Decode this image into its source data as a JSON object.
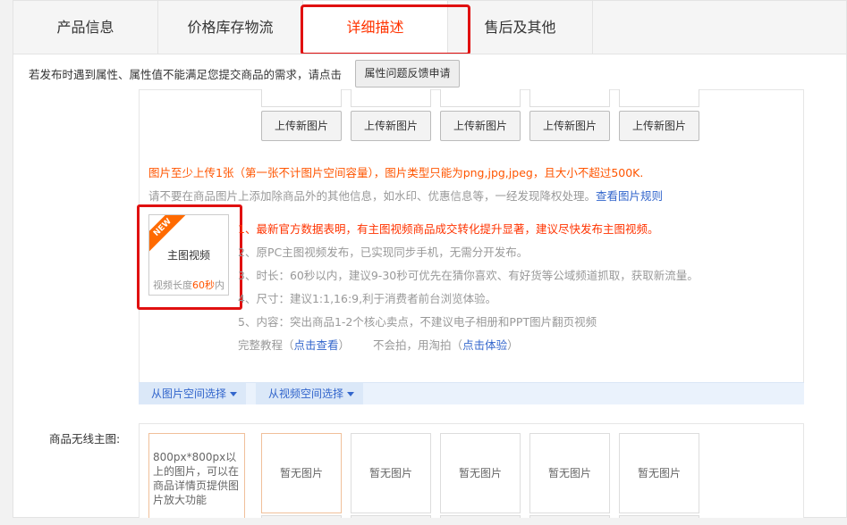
{
  "tabs": [
    {
      "label": "产品信息"
    },
    {
      "label": "价格库存物流"
    },
    {
      "label": "详细描述"
    },
    {
      "label": "售后及其他"
    }
  ],
  "notice": {
    "text": "若发布时遇到属性、属性值不能满足您提交商品的需求，请点击",
    "button_label": "属性问题反馈申请"
  },
  "main_images": {
    "upload_label": "上传新图片",
    "warning": "图片至少上传1张（第一张不计图片空间容量），图片类型只能为png,jpg,jpeg，且大小不超过500K.",
    "tip_text": "请不要在商品图片上添加除商品外的其他信息，如水印、优惠信息等，一经发现降权处理。",
    "tip_link": "查看图片规则"
  },
  "video": {
    "badge": "NEW",
    "title": "主图视频",
    "length_prefix": "视频长度",
    "length_value": "60秒",
    "length_suffix": "内",
    "tips": [
      "1、最新官方数据表明，有主图视频商品成交转化提升显著，建议尽快发布主图视频。",
      "2、原PC主图视频发布，已实现同步手机，无需分开发布。",
      "3、时长：60秒以内，建议9-30秒可优先在猜你喜欢、有好货等公域频道抓取，获取新流量。",
      "4、尺寸：建议1:1,16:9,利于消费者前台浏览体验。",
      "5、内容：突出商品1-2个核心卖点，不建议电子相册和PPT图片翻页视频"
    ],
    "tutorial_prefix": "完整教程（",
    "tutorial_link": "点击查看",
    "tutorial_suffix": "）",
    "taopai_prefix": "不会拍，用淘拍（",
    "taopai_link": "点击体验",
    "taopai_suffix": "）"
  },
  "space_buttons": {
    "image_space": "从图片空间选择",
    "video_space": "从视频空间选择"
  },
  "mobile": {
    "label": "商品无线主图:",
    "hint": "800px*800px以上的图片，可以在商品详情页提供图片放大功能",
    "placeholder": "暂无图片"
  },
  "colors": {
    "active_tab": "#ff3300",
    "warning": "#ff5500",
    "link": "#3366cc",
    "highlight_box": "#e01010"
  }
}
